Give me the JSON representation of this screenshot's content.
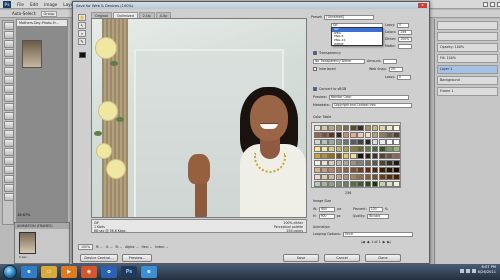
{
  "ps": {
    "menu": [
      "File",
      "Edit",
      "Image",
      "Layer",
      "Select",
      "Filter",
      "View",
      "Window",
      "Help"
    ],
    "logo": "Ps",
    "options": {
      "auto_select": "Auto-Select:",
      "group": "Group"
    },
    "doc_tab": "Mothers-Day-Photo-Fr...",
    "zoom": "16.67%",
    "anim_title": "ANIMATION (FRAMES)",
    "anim_frame_label": "0 sec.",
    "right_panel": [
      "",
      "",
      "Opacity: 100%",
      "Fill: 100%",
      "Layer 1",
      "Background",
      "Frame 1"
    ]
  },
  "dialog": {
    "title": "Save for Web & Devices (100%)",
    "close": "x",
    "view_tabs": [
      "Original",
      "Optimized",
      "2-Up",
      "4-Up"
    ],
    "active_tab": 1,
    "preview_info_left": [
      "GIF",
      "1 Kbits",
      "68 sec @ 56.6 Kbps"
    ],
    "preview_info_right": [
      "100% dither",
      "Perceptual palette",
      "256 colors"
    ],
    "status": {
      "zoom": "100%",
      "r": "R: --",
      "g": "G: --",
      "b": "B: --",
      "alpha": "Alpha: --",
      "hex": "Hex: --",
      "index": "Index: --"
    },
    "buttons": {
      "device_central": "Device Central...",
      "preview": "Preview...",
      "save": "Save",
      "cancel": "Cancel",
      "done": "Done"
    },
    "settings": {
      "preset_label": "Preset:",
      "preset_value": "[Unnamed]",
      "format_value": "GIF",
      "format_options": [
        "GIF",
        "JPEG",
        "PNG-8",
        "PNG-24",
        "WBMP"
      ],
      "lossy_label": "Lossy:",
      "lossy_value": "0",
      "colors_label": "Colors:",
      "colors_value": "256",
      "dither_label": "Dither:",
      "dither_value": "100%",
      "matte_label": "Matte:",
      "transparency_label": "Transparency",
      "no_transparency_dither": "No Transparency Dither",
      "amount_label": "Amount:",
      "interlaced_label": "Interlaced",
      "websnap_label": "Web Snap:",
      "websnap_value": "0%",
      "lossy2_label": "Lossy:",
      "lossy2_value": "0",
      "convert_srgb": "Convert to sRGB",
      "preview_label": "Preview:",
      "preview_value": "Monitor Color",
      "metadata_label": "Metadata:",
      "metadata_value": "Copyright and Contact Info",
      "color_table_label": "Color Table",
      "color_count": "256",
      "image_size_label": "Image Size",
      "w_label": "W:",
      "w_value": "600",
      "h_label": "H:",
      "h_value": "900",
      "px": "px",
      "percent_label": "Percent:",
      "percent_value": "100",
      "percent_unit": "%",
      "quality_label": "Quality:",
      "quality_value": "Bicubic",
      "animation_label": "Animation",
      "looping_label": "Looping Options:",
      "looping_value": "Once",
      "frame_counter": "1 of 1"
    }
  },
  "swatch_colors": [
    "#e8e2d4",
    "#d4c6a8",
    "#b8a580",
    "#9c8a66",
    "#7a6a50",
    "#5a4a36",
    "#3a2e22",
    "#a88c5a",
    "#c7b27c",
    "#e0d3a4",
    "#f0e8c8",
    "#fbf6e2",
    "#9a6447",
    "#7e4e36",
    "#5e3626",
    "#402418",
    "#c48e6a",
    "#dcae8e",
    "#eccbb1",
    "#f5ddca",
    "#b4a076",
    "#8f7d58",
    "#6e5e42",
    "#4f422e",
    "#cfd6d3",
    "#b8c0bd",
    "#a0a8a5",
    "#888f8c",
    "#707572",
    "#585c5a",
    "#404341",
    "#2a2c2b",
    "#d9e0dd",
    "#e9eeeb",
    "#f3f6f4",
    "#ffffff",
    "#f7e98a",
    "#efe7a8",
    "#d9cf82",
    "#c2b860",
    "#a89f46",
    "#8a8232",
    "#6e6622",
    "#5d7e45",
    "#4a6836",
    "#3a5228",
    "#7a9a5a",
    "#9ab77a",
    "#c9a63a",
    "#b38f2a",
    "#8f701e",
    "#6e5414",
    "#e3c76a",
    "#f0dc94",
    "#1a120e",
    "#2e2018",
    "#433024",
    "#5a4232",
    "#715442",
    "#8a6854",
    "#efefe8",
    "#e2e2d8",
    "#cfcfc4",
    "#bcbcb0",
    "#a8a89c",
    "#949488",
    "#808074",
    "#6c6c60",
    "#58584c",
    "#444438",
    "#303026",
    "#1c1c14",
    "#d5b08c",
    "#c49c78",
    "#b38864",
    "#a27452",
    "#916040",
    "#804e30",
    "#6f3e22",
    "#5e3016",
    "#4d240c",
    "#3c1a06",
    "#2b1202",
    "#1a0a00",
    "#eadcc4",
    "#dccab0",
    "#cdb89c",
    "#bfa688",
    "#b09474",
    "#a28260",
    "#93704c",
    "#855e38",
    "#764c26",
    "#683c14",
    "#592c04",
    "#4a1e00",
    "#bcc6b4",
    "#a8b49e",
    "#94a288",
    "#809072",
    "#6c7e5c",
    "#586c46",
    "#445a30",
    "#30481c",
    "#1c3608",
    "#c2d0b0",
    "#d6e2c6",
    "#eaf2dc"
  ],
  "taskbar": {
    "time": "6:07 PM",
    "date": "6/26/2011",
    "icons": [
      "ie",
      "folder",
      "media",
      "firefox",
      "outlook",
      "ps",
      "ie2"
    ]
  }
}
